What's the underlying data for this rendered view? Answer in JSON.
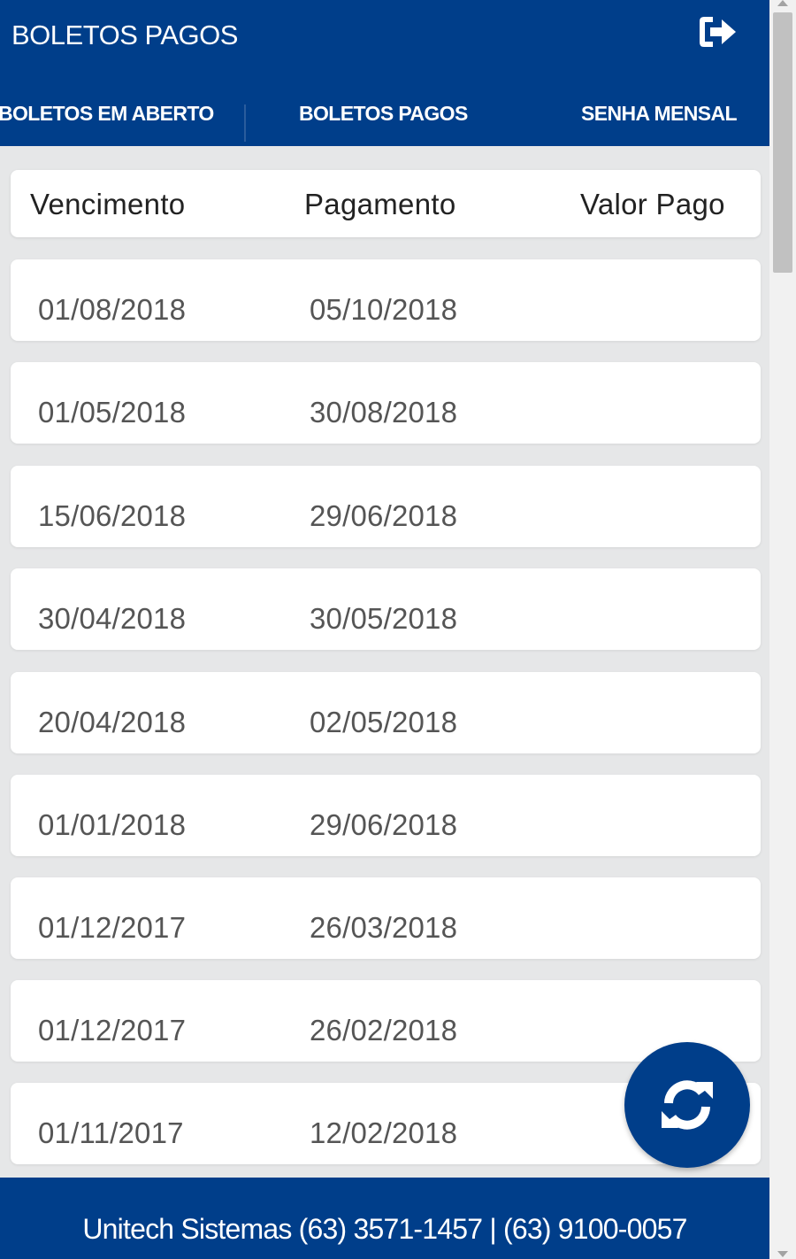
{
  "header": {
    "title": "BOLETOS PAGOS",
    "logout_icon": "sign-out-icon"
  },
  "tabs": [
    {
      "label": "BOLETOS EM ABERTO",
      "active": false
    },
    {
      "label": "BOLETOS PAGOS",
      "active": true
    },
    {
      "label": "SENHA MENSAL",
      "active": false
    }
  ],
  "table": {
    "columns": [
      "Vencimento",
      "Pagamento",
      "Valor Pago"
    ],
    "rows": [
      {
        "vencimento": "01/08/2018",
        "pagamento": "05/10/2018",
        "valor": ""
      },
      {
        "vencimento": "01/05/2018",
        "pagamento": "30/08/2018",
        "valor": ""
      },
      {
        "vencimento": "15/06/2018",
        "pagamento": "29/06/2018",
        "valor": ""
      },
      {
        "vencimento": "30/04/2018",
        "pagamento": "30/05/2018",
        "valor": ""
      },
      {
        "vencimento": "20/04/2018",
        "pagamento": "02/05/2018",
        "valor": ""
      },
      {
        "vencimento": "01/01/2018",
        "pagamento": "29/06/2018",
        "valor": ""
      },
      {
        "vencimento": "01/12/2017",
        "pagamento": "26/03/2018",
        "valor": ""
      },
      {
        "vencimento": "01/12/2017",
        "pagamento": "26/02/2018",
        "valor": ""
      },
      {
        "vencimento": "01/11/2017",
        "pagamento": "12/02/2018",
        "valor": ""
      }
    ]
  },
  "fab": {
    "icon": "refresh-icon"
  },
  "footer": {
    "text": "Unitech Sistemas (63) 3571-1457 | (63) 9100-0057"
  },
  "colors": {
    "primary": "#003e8a",
    "background": "#e6e7e8",
    "card": "#ffffff",
    "header_text": "#222222",
    "row_text": "#555555"
  }
}
